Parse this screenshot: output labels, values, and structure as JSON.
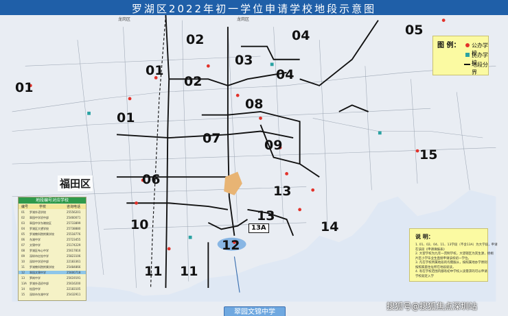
{
  "title": "罗湖区2022年初一学位申请学校地段示意图",
  "district_labels": [
    "01",
    "01",
    "01",
    "02",
    "02",
    "03",
    "04",
    "04",
    "05",
    "06",
    "07",
    "08",
    "09",
    "10",
    "11",
    "11",
    "12",
    "13",
    "13",
    "13A",
    "14",
    "15"
  ],
  "neighbor_label": "福田区",
  "region_labels": {
    "top_left": "龙岗区",
    "top_mid": "龙岗区"
  },
  "legend": {
    "title": "图 例：",
    "items": [
      {
        "label": "公办学校",
        "color": "#e2322a",
        "icon": "red-dot-icon"
      },
      {
        "label": "民办学校",
        "color": "#2aa2a2",
        "icon": "teal-square-icon"
      },
      {
        "label": "地段分界",
        "color": "#111111",
        "icon": "black-line-icon"
      }
    ]
  },
  "table": {
    "title": "地段编号对应学校",
    "headers": [
      "编号",
      "学校",
      "咨询电话"
    ],
    "rows": [
      [
        "01",
        "罗湖外语学校",
        "25556201"
      ],
      [
        "02",
        "翠园中学初中部",
        "25460071"
      ],
      [
        "03",
        "翠园中学东晓校区",
        "25733899"
      ],
      [
        "04",
        "罗湖区大望学校",
        "25738880"
      ],
      [
        "05",
        "罗湖教科院附属学校",
        "25518776"
      ],
      [
        "06",
        "东湖中学",
        "25723455"
      ],
      [
        "07",
        "文锦中学",
        "25174229"
      ],
      [
        "08",
        "罗湖区布心中学",
        "25617816"
      ],
      [
        "09",
        "深圳市红桂中学",
        "25823106"
      ],
      [
        "10",
        "深圳中学初中部",
        "22183361"
      ],
      [
        "11",
        "罗湖教科院附属学校",
        "25484866"
      ],
      [
        "12",
        "翠园文锦中学",
        "25600718"
      ],
      [
        "13",
        "笋岗中学",
        "25619191"
      ],
      [
        "13A",
        "罗湖外语初中部",
        "25616200"
      ],
      [
        "14",
        "桂园中学",
        "22183105"
      ],
      [
        "15",
        "深圳市东湖中学",
        "25432911"
      ]
    ],
    "highlight_row": 11
  },
  "notes": {
    "title": "说  明：",
    "lines": [
      "1. 01、02、04、11、13学段（不含13A）为大学段，申请",
      "在该段《申请填报表》",
      "2. 大望学校为九年一贯制学校，大望辖区为其生源，梧桐",
      "片区小学毕业生直接申请该校初一学位。",
      "3. 凡在学校所属地段的均需服从，按照属地办学原则",
      "按照家庭住址所在地段就读，",
      "4. 有在学校范围内都有初中学校入读需求的可以申请",
      "学校就近入学"
    ]
  },
  "school_highlight": "翠园文锦中学",
  "watermark": "搜狐号@搜狐焦点深圳站",
  "colors": {
    "title_bar": "#1f5fa8",
    "map_bg": "#e9edf3",
    "water": "#cfe0f3",
    "highlight_area": "#6fa8e0",
    "public_school": "#e2322a",
    "private_school": "#2aa2a2"
  }
}
